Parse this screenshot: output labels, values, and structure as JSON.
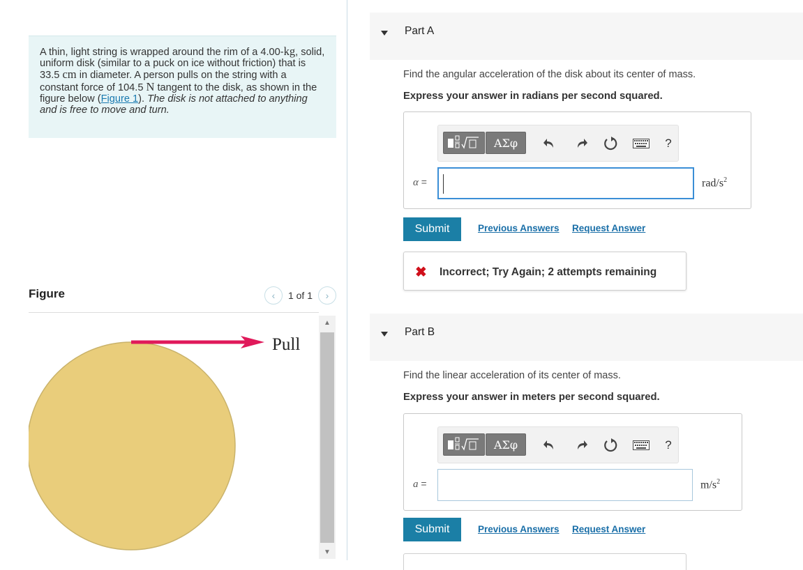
{
  "problem": {
    "text_1": "A thin, light string is wrapped around the rim of a 4.00-",
    "unit_kg": "kg",
    "text_2": ", solid, uniform disk (similar to a puck on ice without friction) that is 33.5 ",
    "unit_cm": "cm",
    "text_3": " in diameter. A person pulls on the string with a constant force of 104.5 ",
    "unit_N": "N",
    "text_4": " tangent to the disk, as shown in the figure below (",
    "figure_link": "Figure 1",
    "text_5": "). ",
    "italic_text": "The disk is not attached to anything and is free to move and turn."
  },
  "figure": {
    "title": "Figure",
    "pager_text": "1 of 1",
    "prev_icon": "chevron-left-icon",
    "next_icon": "chevron-right-icon",
    "pull_label": "Pull",
    "disk_color": "#e9cd7b",
    "disk_stroke": "#c9b26a",
    "arrow_color": "#e0195a"
  },
  "partA": {
    "title": "Part A",
    "prompt": "Find the angular acceleration of the disk about its center of mass.",
    "instruction": "Express your answer in radians per second squared.",
    "var_label": "α",
    "equals": " =",
    "input_value": "",
    "unit_base": "rad/s",
    "unit_exp": "2",
    "submit_label": "Submit",
    "prev_answers_label": "Previous Answers",
    "request_answer_label": "Request Answer",
    "feedback_icon": "x-mark-icon",
    "feedback_text": "Incorrect; Try Again; 2 attempts remaining"
  },
  "partB": {
    "title": "Part B",
    "prompt": "Find the linear acceleration of its center of mass.",
    "instruction": "Express your answer in meters per second squared.",
    "var_label": "a",
    "equals": " =",
    "input_value": "",
    "unit_base": "m/s",
    "unit_exp": "2",
    "submit_label": "Submit",
    "prev_answers_label": "Previous Answers",
    "request_answer_label": "Request Answer"
  },
  "toolbar": {
    "greek_label": "ΑΣφ",
    "help_label": "?",
    "icons": [
      "templates-icon",
      "greek-letters-icon",
      "undo-icon",
      "redo-icon",
      "reset-icon",
      "keyboard-icon",
      "help-icon"
    ]
  },
  "colors": {
    "accent": "#1b7fa6",
    "link": "#1a6fa8",
    "error": "#d0101b",
    "problem_bg": "#e8f5f6"
  }
}
